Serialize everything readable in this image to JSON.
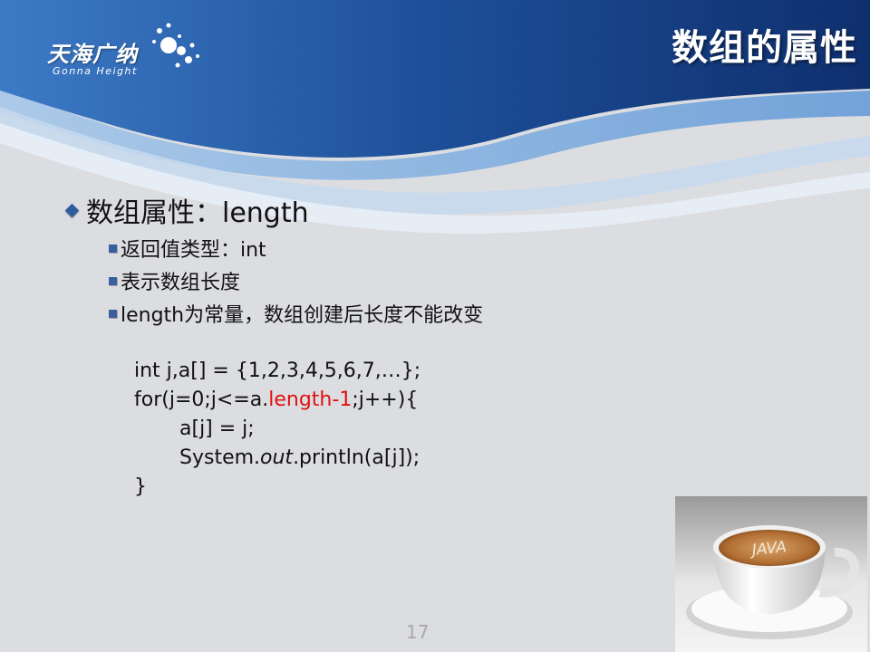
{
  "header": {
    "logo_cn": "天海广纳",
    "logo_en": "Gonna Height",
    "title": "数组的属性"
  },
  "bullets": {
    "main": "数组属性：length",
    "subs": [
      "返回值类型：int",
      "表示数组长度",
      "length为常量，数组创建后长度不能改变"
    ]
  },
  "code": {
    "line1": "int j,a[] = {1,2,3,4,5,6,7,…};",
    "line2_pre": "for(j=0;j<=a.",
    "line2_red": "length-1",
    "line2_post": ";j++){",
    "line3": "a[j] = j;",
    "line4_pre": "System.",
    "line4_it": "out",
    "line4_post": ".println(a[j]);",
    "line5": "}"
  },
  "footer": {
    "page_number": "17"
  },
  "image": {
    "cup_text": "JAVA"
  },
  "colors": {
    "header_dark": "#123a7a",
    "header_mid": "#2f6bb8",
    "bullet": "#2f5b9f",
    "highlight": "#e01010"
  }
}
